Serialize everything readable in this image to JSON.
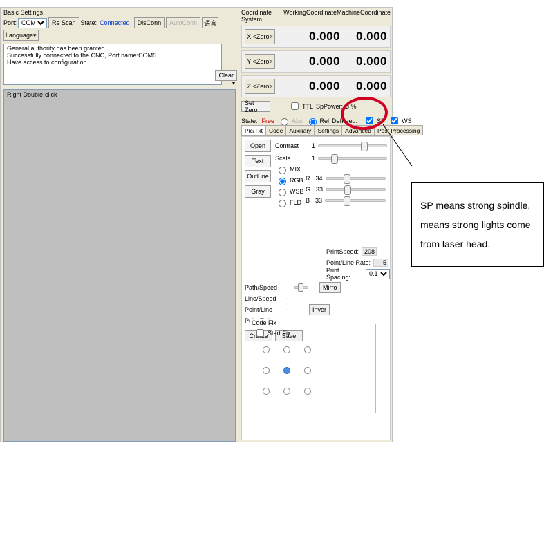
{
  "basic": {
    "caption": "Basic Settings",
    "port_label": "Port:",
    "port_value": "COM5",
    "rescan": "Re Scan",
    "state_label": "State:",
    "state_value": "Connected",
    "disconn": "DisConn",
    "autoconn": "AutoConn",
    "lang_cn": "语言",
    "language": "Language",
    "log_line1": "General authority has been granted.",
    "log_line2": "Successfully connected to the CNC, Port name:COM5",
    "log_line3": "Have access to configuration.",
    "clear": "Clear",
    "canvas_hint": "Right Double-click"
  },
  "coord": {
    "title": "Coordinate System",
    "working": "WorkingCoordinate",
    "machine": "MachineCoordinate",
    "x_btn": "X <Zero>",
    "y_btn": "Y <Zero>",
    "z_btn": "Z <Zero>",
    "x_wc": "0.000",
    "x_mc": "0.000",
    "y_wc": "0.000",
    "y_mc": "0.000",
    "z_wc": "0.000",
    "z_mc": "0.000",
    "set_zero": "Set Zero",
    "ttl": "TTL",
    "sp_power_lbl": "SpPower:",
    "sp_power_val": "3 %",
    "state_lbl": "State:",
    "state_val": "Free",
    "abs": "Abs",
    "rel": "Rel",
    "def_feed": "DefFeed:",
    "sp": "SP",
    "ws": "WS"
  },
  "tabs": {
    "t0": "Pic/Txt",
    "t1": "Code",
    "t2": "Auxiliary",
    "t3": "Settings",
    "t4": "Advanced",
    "t5": "Post Processing"
  },
  "pic": {
    "open": "Open",
    "text": "Text",
    "outline": "OutLine",
    "gray": "Gray",
    "contrast_lbl": "Contrast",
    "contrast_val": "1",
    "scale_lbl": "Scale",
    "scale_val": "1",
    "mode_mix": "MIX",
    "mode_rgb": "RGB",
    "mode_wsb": "WSB",
    "mode_fld": "FLD",
    "r_lbl": "R",
    "r_val": "34",
    "g_lbl": "G",
    "g_val": "33",
    "b_lbl": "B",
    "b_val": "33",
    "path_speed": "Path/Speed",
    "line_speed": "Line/Speed",
    "point_line": "Point/Line",
    "point_point": "Point/Point",
    "dash": "-",
    "mirror": "Mirro",
    "invert": "Inver",
    "print_speed_lbl": "PrintSpeed:",
    "print_speed_val": "208",
    "point_line_rate_lbl": "Point/Line Rate:",
    "point_line_rate_val": "5",
    "print_spacing_lbl": "Print Spacing:",
    "print_spacing_val": "0.1",
    "create": "Create",
    "save": "Save",
    "codefix_legend": "Code Fix",
    "start_fix": "Start Fix"
  },
  "callout": {
    "text": "SP means strong spindle, means strong lights come from laser head."
  }
}
